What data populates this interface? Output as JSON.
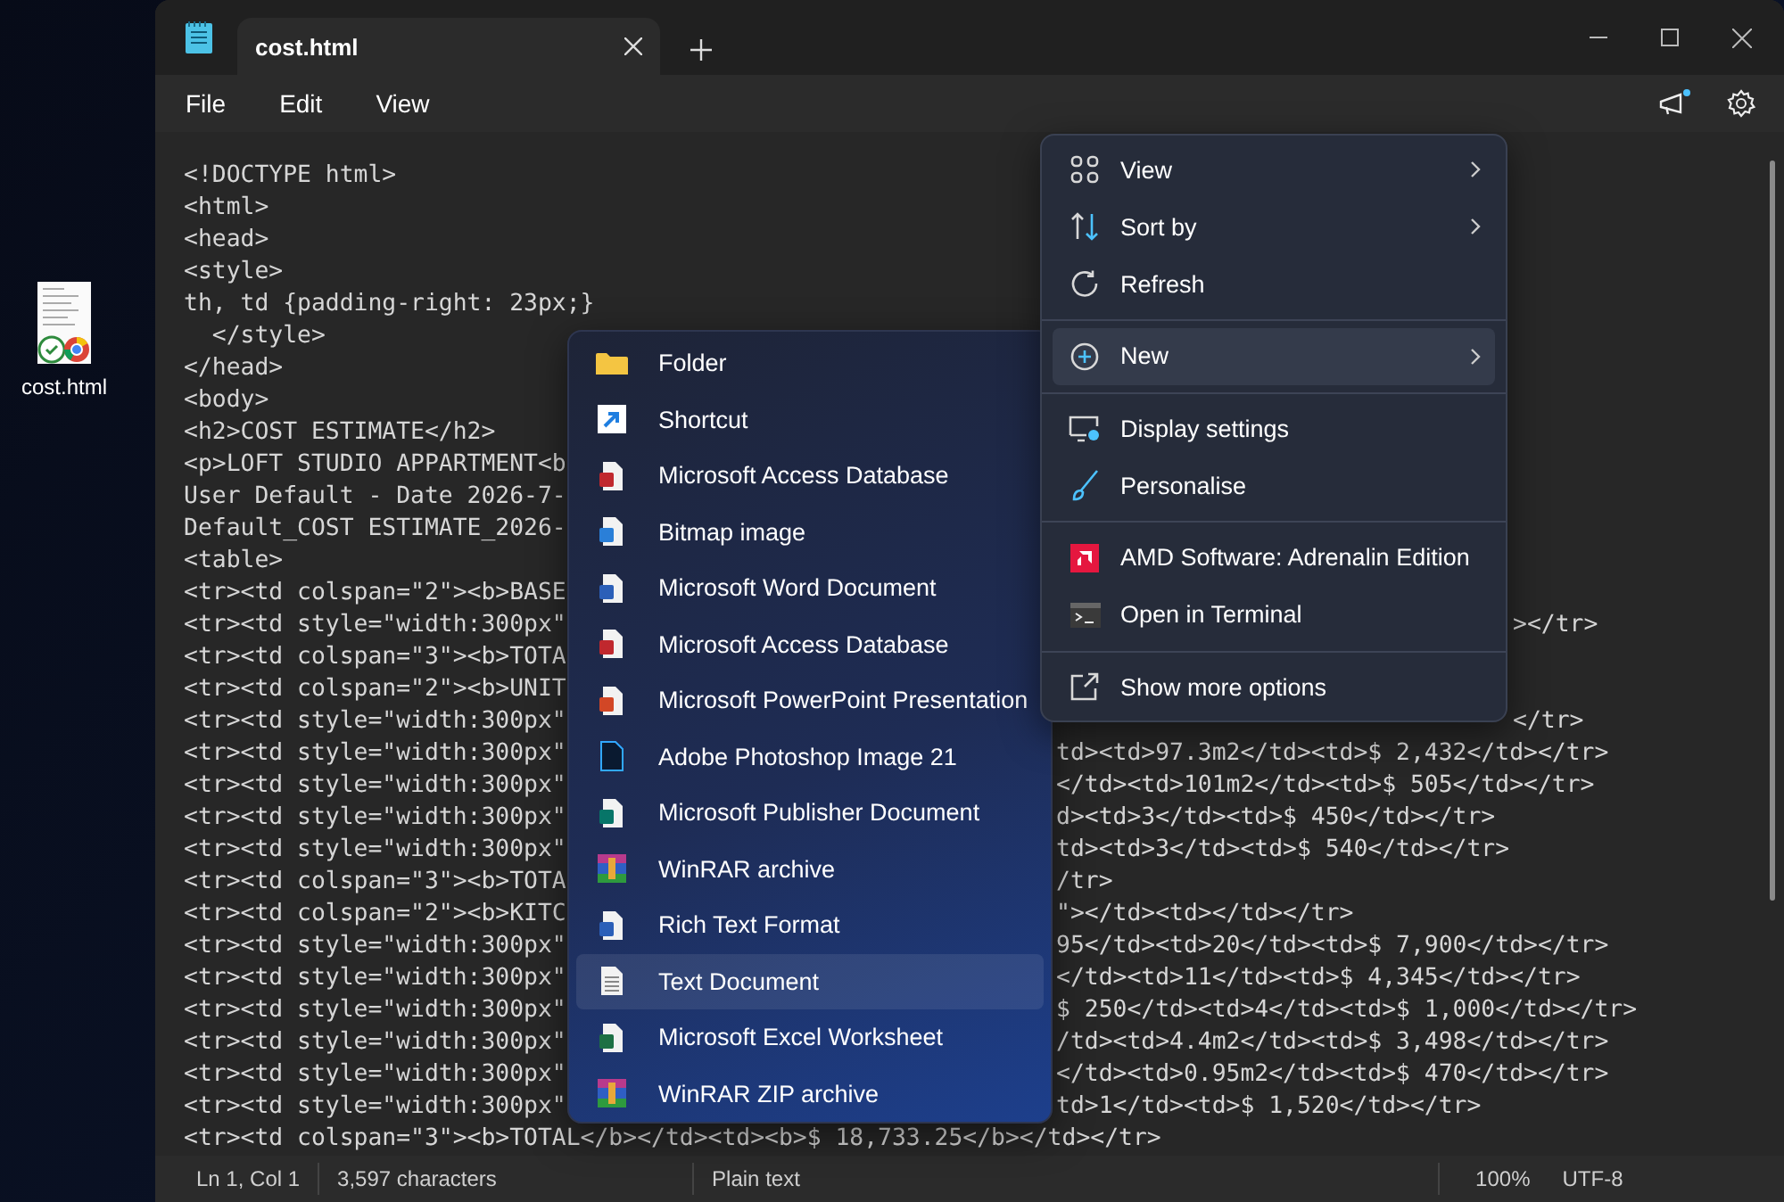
{
  "desktop": {
    "icons": [
      {
        "label": "cost.html"
      }
    ]
  },
  "window": {
    "tab": {
      "title": "cost.html"
    }
  },
  "menu_bar": {
    "items": [
      "File",
      "Edit",
      "View"
    ]
  },
  "editor": {
    "lines": [
      {
        "kind": "full",
        "text": "<!DOCTYPE html>"
      },
      {
        "kind": "full",
        "text": "<html>"
      },
      {
        "kind": "full",
        "text": "<head>"
      },
      {
        "kind": "full",
        "text": "<style>"
      },
      {
        "kind": "full",
        "text": "th, td {padding-right: 23px;}"
      },
      {
        "kind": "full",
        "text": "  </style>"
      },
      {
        "kind": "full",
        "text": "</head>"
      },
      {
        "kind": "full",
        "text": "<body>"
      },
      {
        "kind": "full",
        "text": "<h2>COST ESTIMATE</h2>"
      },
      {
        "kind": "split",
        "start": "<p>LOFT STUDIO APPARTMENT<b"
      },
      {
        "kind": "split",
        "start": "User Default - Date 2026-7-"
      },
      {
        "kind": "split",
        "start": "Default_COST ESTIMATE_2026-"
      },
      {
        "kind": "full",
        "text": "<table>"
      },
      {
        "kind": "split",
        "start": "<tr><td colspan=\"2\"><b>BASE"
      },
      {
        "kind": "split",
        "start": "<tr><td style=\"width:300px\"",
        "end": "></tr>"
      },
      {
        "kind": "split",
        "start": "<tr><td colspan=\"3\"><b>TOTA"
      },
      {
        "kind": "split",
        "start": "<tr><td colspan=\"2\"><b>UNIT"
      },
      {
        "kind": "split",
        "start": "<tr><td style=\"width:300px\"",
        "end": "</tr>"
      },
      {
        "kind": "split",
        "start": "<tr><td style=\"width:300px\"",
        "end": "td><td>97.3m2</td><td>$ 2,432</td></tr>"
      },
      {
        "kind": "split",
        "start": "<tr><td style=\"width:300px\"",
        "end": "</td><td>101m2</td><td>$ 505</td></tr>"
      },
      {
        "kind": "split",
        "start": "<tr><td style=\"width:300px\"",
        "end": "d><td>3</td><td>$ 450</td></tr>"
      },
      {
        "kind": "split",
        "start": "<tr><td style=\"width:300px\"",
        "end": "td><td>3</td><td>$ 540</td></tr>"
      },
      {
        "kind": "split",
        "start": "<tr><td colspan=\"3\"><b>TOTA",
        "end": "/tr>"
      },
      {
        "kind": "split",
        "start": "<tr><td colspan=\"2\"><b>KITC",
        "end": "\"></td><td></td></tr>"
      },
      {
        "kind": "split",
        "start": "<tr><td style=\"width:300px\"",
        "end": "95</td><td>20</td><td>$ 7,900</td></tr>"
      },
      {
        "kind": "split",
        "start": "<tr><td style=\"width:300px\"",
        "end": "</td><td>11</td><td>$ 4,345</td></tr>"
      },
      {
        "kind": "split",
        "start": "<tr><td style=\"width:300px\"",
        "end": "$ 250</td><td>4</td><td>$ 1,000</td></tr>"
      },
      {
        "kind": "split",
        "start": "<tr><td style=\"width:300px\"",
        "end": "/td><td>4.4m2</td><td>$ 3,498</td></tr>"
      },
      {
        "kind": "split",
        "start": "<tr><td style=\"width:300px\"",
        "end": "</td><td>0.95m2</td><td>$ 470</td></tr>"
      },
      {
        "kind": "split",
        "start": "<tr><td style=\"width:300px\"",
        "end": "td>1</td><td>$ 1,520</td></tr>"
      },
      {
        "kind": "full",
        "text": "<tr><td colspan=\"3\"><b>TOTAL</b></td><td><b>$ 18,733.25</b></td></tr>"
      }
    ]
  },
  "status_bar": {
    "position": "Ln 1, Col 1",
    "characters": "3,597 characters",
    "format": "Plain text",
    "zoom": "100%",
    "encoding": "UTF-8"
  },
  "context_menu": {
    "groups": [
      [
        {
          "label": "View",
          "has_submenu": true,
          "selected": false
        },
        {
          "label": "Sort by",
          "has_submenu": true,
          "selected": false
        },
        {
          "label": "Refresh",
          "has_submenu": false,
          "selected": false
        }
      ],
      [
        {
          "label": "New",
          "has_submenu": true,
          "selected": true
        }
      ],
      [
        {
          "label": "Display settings",
          "has_submenu": false,
          "selected": false
        },
        {
          "label": "Personalise",
          "has_submenu": false,
          "selected": false
        }
      ],
      [
        {
          "label": "AMD Software: Adrenalin Edition",
          "has_submenu": false,
          "selected": false
        },
        {
          "label": "Open in Terminal",
          "has_submenu": false,
          "selected": false
        }
      ],
      [
        {
          "label": "Show more options",
          "has_submenu": false,
          "selected": false
        }
      ]
    ]
  },
  "new_submenu": {
    "items": [
      {
        "label": "Folder",
        "selected": false
      },
      {
        "label": "Shortcut",
        "selected": false
      },
      {
        "label": "Microsoft Access Database",
        "selected": false
      },
      {
        "label": "Bitmap image",
        "selected": false
      },
      {
        "label": "Microsoft Word Document",
        "selected": false
      },
      {
        "label": "Microsoft Access Database",
        "selected": false
      },
      {
        "label": "Microsoft PowerPoint Presentation",
        "selected": false
      },
      {
        "label": "Adobe Photoshop Image 21",
        "selected": false
      },
      {
        "label": "Microsoft Publisher Document",
        "selected": false
      },
      {
        "label": "WinRAR archive",
        "selected": false
      },
      {
        "label": "Rich Text Format",
        "selected": false
      },
      {
        "label": "Text Document",
        "selected": true
      },
      {
        "label": "Microsoft Excel Worksheet",
        "selected": false
      },
      {
        "label": "WinRAR ZIP archive",
        "selected": false
      }
    ]
  }
}
